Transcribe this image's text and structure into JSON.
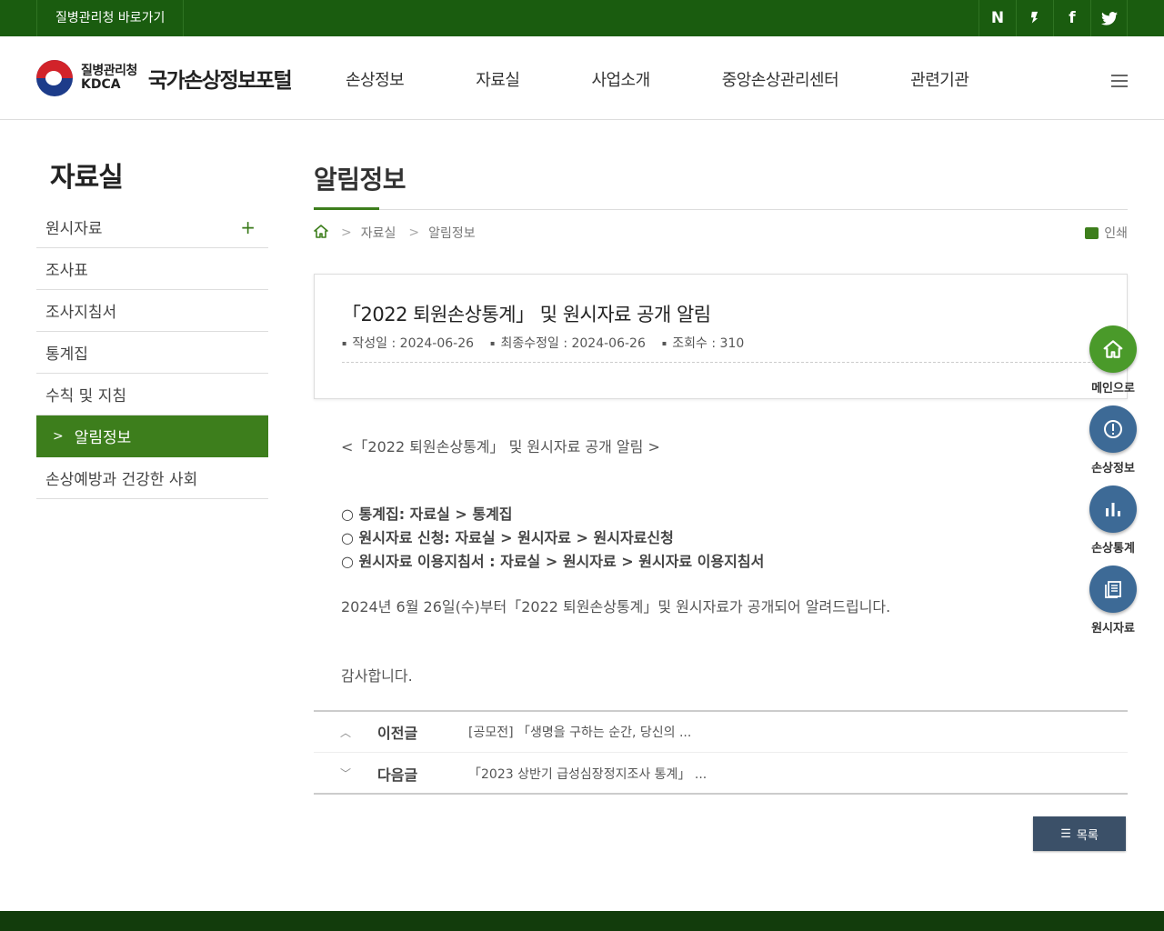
{
  "topbar": {
    "kdca_link": "질병관리청 바로가기",
    "sns": [
      {
        "icon": "naver-blog-icon",
        "glyph": "N"
      },
      {
        "icon": "kakao-story-icon",
        "glyph": "❜"
      },
      {
        "icon": "facebook-icon",
        "glyph": "f"
      },
      {
        "icon": "twitter-icon",
        "glyph": "🐦"
      }
    ]
  },
  "header": {
    "logo_korean": "질병관리청",
    "logo_english": "KDCA",
    "site_title": "국가손상정보포털",
    "gnb": [
      "손상정보",
      "자료실",
      "사업소개",
      "중앙손상관리센터",
      "관련기관"
    ]
  },
  "sidebar": {
    "title": "자료실",
    "items": [
      {
        "label": "원시자료",
        "expandable": "+"
      },
      {
        "label": "조사표"
      },
      {
        "label": "조사지침서"
      },
      {
        "label": "통계집"
      },
      {
        "label": "수칙 및 지침"
      },
      {
        "label": "알림정보",
        "active": true
      },
      {
        "label": "손상예방과 건강한 사회"
      }
    ]
  },
  "content": {
    "page_title": "알림정보",
    "breadcrumb": [
      "자료실",
      "알림정보"
    ],
    "print_label": "인쇄",
    "post": {
      "title": "「2022 퇴원손상통계」 및 원시자료 공개 알림",
      "meta_created": "작성일 : 2024-06-26",
      "meta_modified": "최종수정일 : 2024-06-26",
      "meta_views": "조회수 : 310"
    },
    "body": {
      "line1": "<「2022 퇴원손상통계」 및 원시자료 공개 알림 >",
      "link1": "○ 통계집: 자료실 > 통계집",
      "link2": "○ 원시자료 신청: 자료실 > 원시자료 > 원시자료신청",
      "link3": "○ 원시자료 이용지침서 : 자료실 > 원시자료 > 원시자료 이용지침서",
      "line5": "2024년 6월 26일(수)부터「2022 퇴원손상통계」및 원시자료가 공개되어 알려드립니다.",
      "line6": "감사합니다."
    },
    "prev": {
      "label": "이전글",
      "title": "[공모전] 「생명을 구하는 순간, 당신의 ..."
    },
    "next": {
      "label": "다음글",
      "title": "「2023 상반기 급성심장정지조사 통계」 ..."
    },
    "list_button": "목록"
  },
  "quick_menu": [
    {
      "label": "메인으로",
      "icon": "home-icon",
      "color": "#4a9a2a"
    },
    {
      "label": "손상정보",
      "icon": "alert-icon",
      "color": "#3d6a96"
    },
    {
      "label": "손상통계",
      "icon": "bar-chart-icon",
      "color": "#3d6a96"
    },
    {
      "label": "원시자료",
      "icon": "document-icon",
      "color": "#3d6a96"
    }
  ],
  "colors": {
    "brand_green": "#1a5c0f",
    "active_green": "#3d7e1c",
    "button_navy": "#3b5068"
  }
}
